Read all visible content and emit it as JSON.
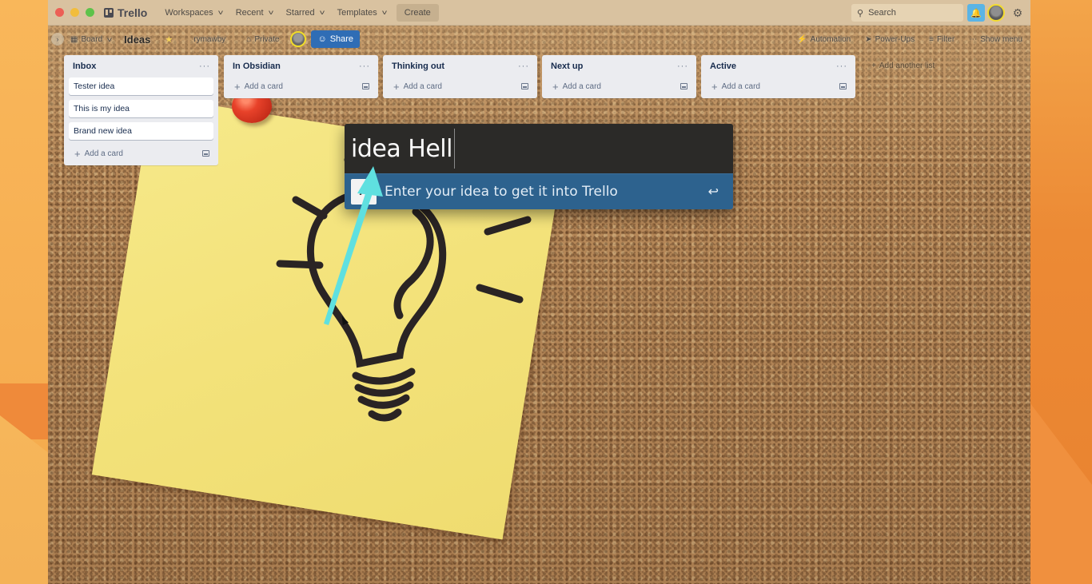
{
  "app": {
    "name": "Trello"
  },
  "topbar": {
    "menus": [
      {
        "label": "Workspaces"
      },
      {
        "label": "Recent"
      },
      {
        "label": "Starred"
      },
      {
        "label": "Templates"
      }
    ],
    "create_label": "Create",
    "search_placeholder": "Search",
    "icons": {
      "search": "search-icon",
      "bell": "bell-icon",
      "settings": "gear-icon"
    }
  },
  "board": {
    "view_label": "Board",
    "title": "Ideas",
    "workspace": "rymawby",
    "visibility": "Private",
    "share_label": "Share",
    "actions": [
      {
        "label": "Automation",
        "icon": "lightning-icon"
      },
      {
        "label": "Power-Ups",
        "icon": "rocket-icon"
      },
      {
        "label": "Filter",
        "icon": "filter-icon"
      },
      {
        "label": "Show menu",
        "icon": "dots-icon"
      }
    ],
    "add_list_label": "Add another list",
    "lists": [
      {
        "title": "Inbox",
        "cards": [
          "Tester idea",
          "This is my idea",
          "Brand new idea"
        ],
        "add_label": "Add a card"
      },
      {
        "title": "In Obsidian",
        "cards": [],
        "add_label": "Add a card"
      },
      {
        "title": "Thinking out",
        "cards": [],
        "add_label": "Add a card"
      },
      {
        "title": "Next up",
        "cards": [],
        "add_label": "Add a card"
      },
      {
        "title": "Active",
        "cards": [],
        "add_label": "Add a card"
      }
    ]
  },
  "launcher": {
    "query": "idea Hell",
    "result_label": "Enter your idea to get it into Trello",
    "result_icon_glyph": "A",
    "enter_glyph": "↩"
  },
  "annotation": {
    "arrow_color": "#5fe0e0"
  },
  "colors": {
    "share_button": "#2f6db5",
    "notification_bell": "#5bb4e5",
    "launcher_result_bg": "#2d628e",
    "launcher_input_bg": "#2b2a28"
  }
}
